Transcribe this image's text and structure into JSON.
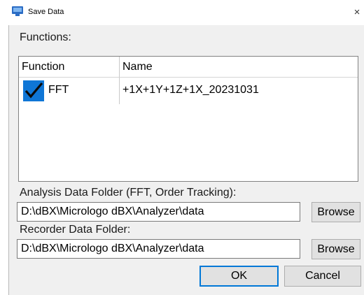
{
  "window": {
    "title": "Save Data",
    "close_glyph": "×",
    "icon": "window-app-icon"
  },
  "functions_label": "Functions:",
  "table": {
    "columns": [
      "Function",
      "Name"
    ],
    "rows": [
      {
        "checked": true,
        "function": "FFT",
        "name": "+1X+1Y+1Z+1X_20231031"
      }
    ]
  },
  "analysis": {
    "label": "Analysis Data Folder (FFT, Order Tracking):",
    "path": "D:\\dBX\\Micrologo dBX\\Analyzer\\data",
    "browse_label": "Browse"
  },
  "recorder": {
    "label": "Recorder Data Folder:",
    "path": "D:\\dBX\\Micrologo dBX\\Analyzer\\data",
    "browse_label": "Browse"
  },
  "buttons": {
    "ok_label": "OK",
    "cancel_label": "Cancel"
  },
  "colors": {
    "accent": "#0078d7",
    "checkbox": "#0f76d6"
  }
}
